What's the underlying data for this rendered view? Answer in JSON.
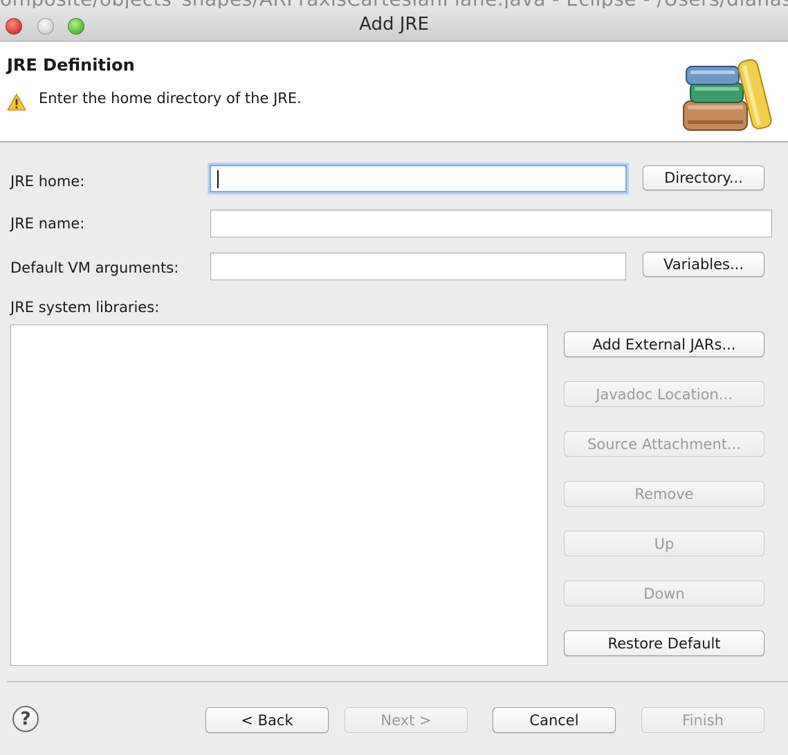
{
  "window": {
    "background_title": "omposite/objects_shapes/ARPraxisCartesianPlane.java - Eclipse - /Users/dianasor",
    "title": "Add JRE"
  },
  "header": {
    "title": "JRE Definition",
    "message": "Enter the home directory of the JRE.",
    "message_icon": "warning-icon",
    "banner_icon": "library-books-icon"
  },
  "form": {
    "jre_home_label": "JRE home:",
    "jre_home_value": "",
    "directory_button": "Directory...",
    "jre_name_label": "JRE name:",
    "jre_name_value": "",
    "vm_args_label": "Default VM arguments:",
    "vm_args_value": "",
    "variables_button": "Variables...",
    "libraries_label": "JRE system libraries:"
  },
  "library_buttons": {
    "add_external_jars": "Add External JARs...",
    "javadoc_location": "Javadoc Location...",
    "source_attachment": "Source Attachment...",
    "remove": "Remove",
    "up": "Up",
    "down": "Down",
    "restore_default": "Restore Default"
  },
  "footer": {
    "help_glyph": "?",
    "back": "< Back",
    "next": "Next >",
    "cancel": "Cancel",
    "finish": "Finish"
  },
  "colors": {
    "focus_ring": "#7fa8e4",
    "disabled_text": "#9a9a9a",
    "close_light": "#e0443a",
    "maximize_light": "#5fc23d"
  }
}
